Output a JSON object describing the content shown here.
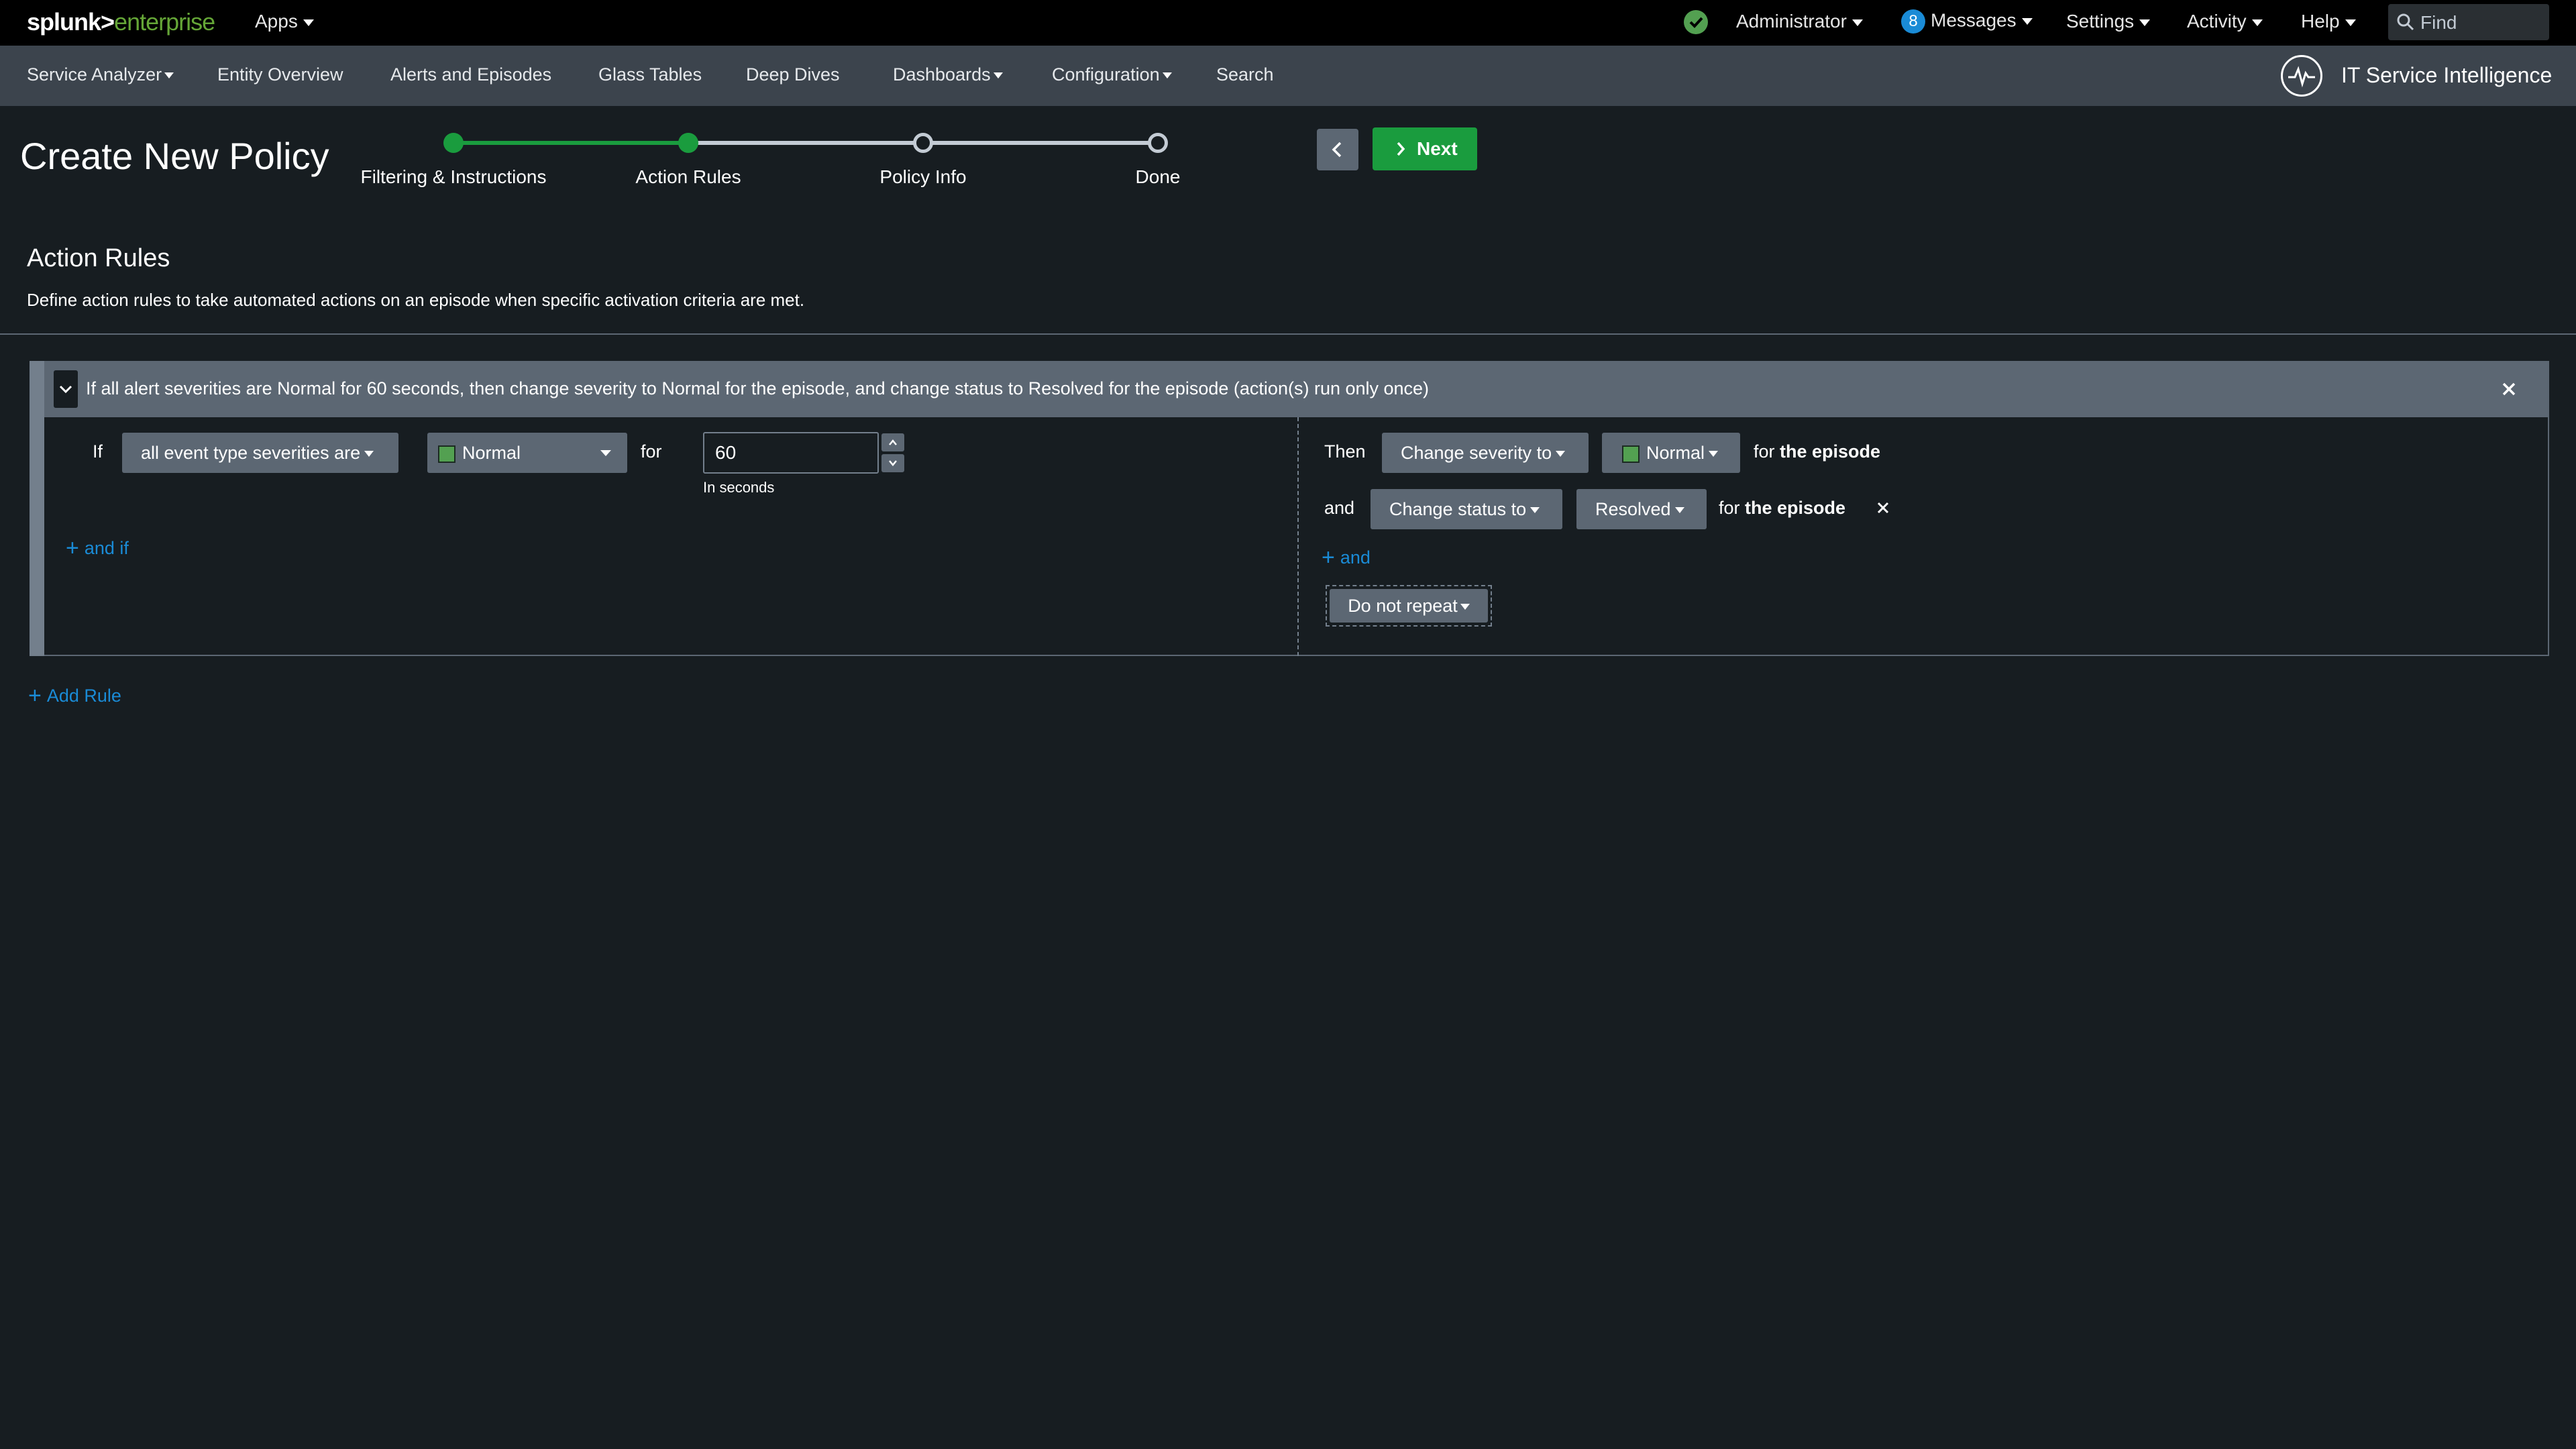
{
  "topbar": {
    "brand_main": "splunk>",
    "brand_sub": "enterprise",
    "apps": "Apps",
    "administrator": "Administrator",
    "messages_count": "8",
    "messages": "Messages",
    "settings": "Settings",
    "activity": "Activity",
    "help": "Help",
    "find_placeholder": "Find"
  },
  "navbar": {
    "items": [
      {
        "label": "Service Analyzer",
        "dropdown": true
      },
      {
        "label": "Entity Overview",
        "dropdown": false
      },
      {
        "label": "Alerts and Episodes",
        "dropdown": false
      },
      {
        "label": "Glass Tables",
        "dropdown": false
      },
      {
        "label": "Deep Dives",
        "dropdown": false
      },
      {
        "label": "Dashboards",
        "dropdown": true
      },
      {
        "label": "Configuration",
        "dropdown": true
      },
      {
        "label": "Search",
        "dropdown": false
      }
    ],
    "app_title": "IT Service Intelligence"
  },
  "header": {
    "title": "Create New Policy",
    "steps": [
      {
        "label": "Filtering & Instructions",
        "state": "complete"
      },
      {
        "label": "Action Rules",
        "state": "current"
      },
      {
        "label": "Policy Info",
        "state": "pending"
      },
      {
        "label": "Done",
        "state": "pending"
      }
    ],
    "next_label": "Next"
  },
  "section": {
    "title": "Action Rules",
    "description": "Define action rules to take automated actions on an episode when specific activation criteria are met."
  },
  "rule": {
    "summary": "If all alert severities are Normal for 60 seconds, then change severity to Normal for the episode, and change status to Resolved for the episode (action(s) run only once)",
    "condition": {
      "if_label": "If",
      "type": "all event type severities are",
      "severity": "Normal",
      "for_label": "for",
      "duration": "60",
      "duration_hint": "In seconds",
      "add_condition": "and if"
    },
    "actions": [
      {
        "prefix": "Then",
        "action": "Change severity to",
        "value": "Normal",
        "target_pre": "for",
        "target": "the episode"
      },
      {
        "prefix": "and",
        "action": "Change status to",
        "value": "Resolved",
        "target_pre": "for",
        "target": "the episode"
      }
    ],
    "add_action": "and",
    "repeat": "Do not repeat"
  },
  "add_rule": "Add Rule",
  "colors": {
    "background": "#171d21",
    "topbar": "#000000",
    "navbar": "#3c444d",
    "success": "#1a9c3e",
    "link": "#1a8bd6",
    "severity_normal": "#53a051"
  }
}
